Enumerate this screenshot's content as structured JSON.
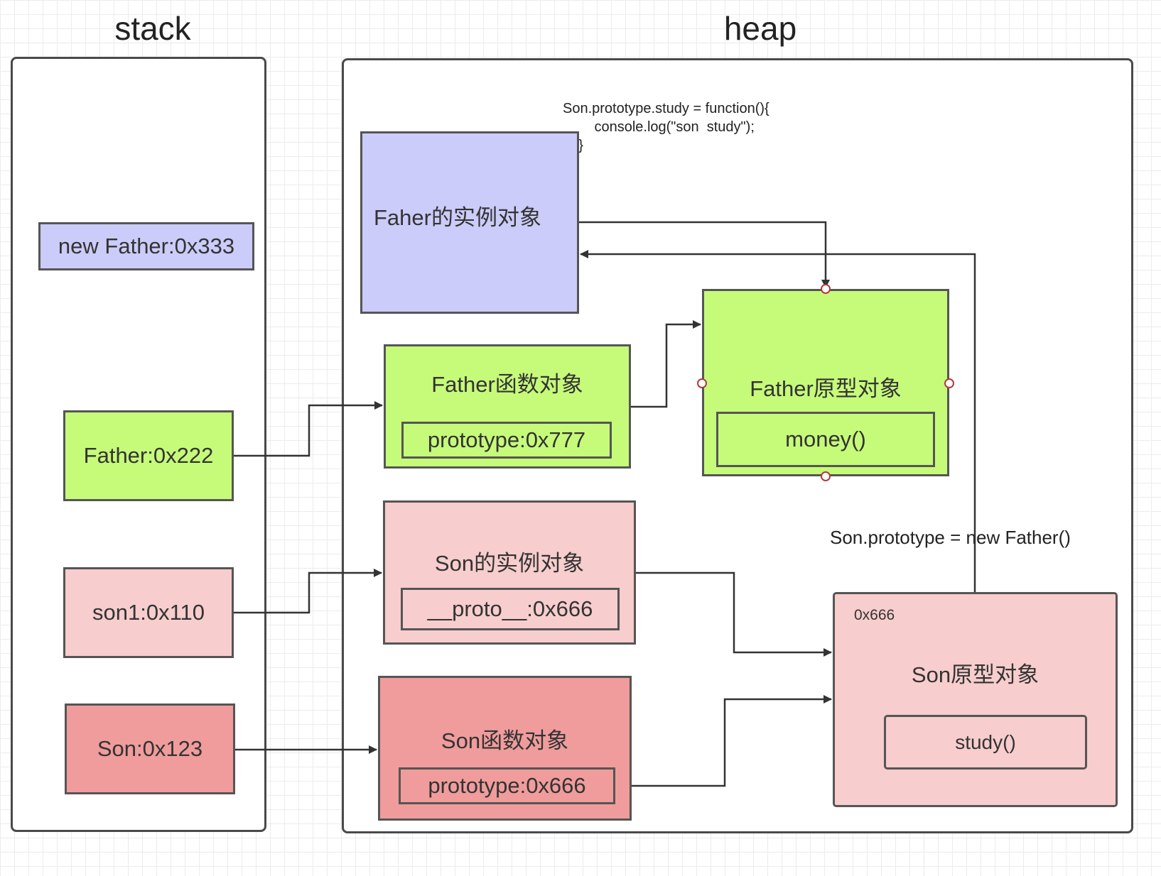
{
  "titles": {
    "stack": "stack",
    "heap": "heap"
  },
  "stack": {
    "new_father": "new Father:0x333",
    "father": "Father:0x222",
    "son1": "son1:0x110",
    "son": "Son:0x123"
  },
  "heap": {
    "father_instance": "Faher的实例对象",
    "father_function": {
      "label": "Father函数对象",
      "prop": "prototype:0x777"
    },
    "father_prototype": {
      "label": "Father原型对象",
      "method": "money()"
    },
    "son_instance": {
      "label": "Son的实例对象",
      "prop": "__proto__:0x666"
    },
    "son_function": {
      "label": "Son函数对象",
      "prop": "prototype:0x666"
    },
    "son_prototype": {
      "address": "0x666",
      "label": "Son原型对象",
      "method": "study()"
    }
  },
  "annotations": {
    "code": "Son.prototype.study = function(){\n        console.log(\"son  study\");\n    }",
    "assignment": "Son.prototype = new Father()"
  },
  "colors": {
    "purple": "#ccccfa",
    "green": "#c6fb7a",
    "pink_light": "#f7cdcd",
    "pink_dark": "#f09c9c",
    "line": "#333333",
    "port_stroke": "#b33a3a"
  }
}
